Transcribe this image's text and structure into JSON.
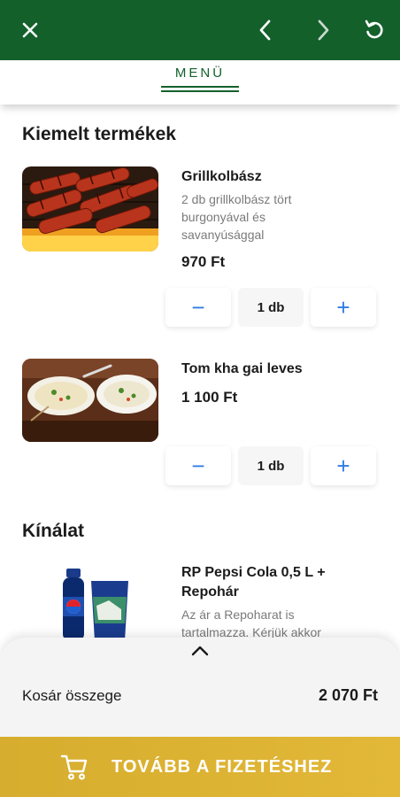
{
  "header": {
    "close_icon": "close-icon",
    "back_icon": "chevron-left-icon",
    "forward_icon": "chevron-right-icon",
    "refresh_icon": "refresh-icon",
    "bg_color": "#13602b"
  },
  "tabs": {
    "menu_label": "MENÜ"
  },
  "featured": {
    "title": "Kiemelt termékek",
    "items": [
      {
        "name": "Grillkolbász",
        "description": "2 db grillkolbász tört burgonyával és savanyúsággal",
        "price": "970 Ft",
        "quantity": "1 db",
        "minus": "−",
        "plus": "+"
      },
      {
        "name": "Tom kha gai leves",
        "price": "1 100 Ft",
        "quantity": "1 db",
        "minus": "−",
        "plus": "+"
      }
    ]
  },
  "offer": {
    "title": "Kínálat",
    "items": [
      {
        "name": "RP Pepsi Cola 0,5 L + Repohár",
        "description": "Az ár a Repoharat is tartalmazza. Kérjük akkor"
      }
    ]
  },
  "cart": {
    "label": "Kosár összege",
    "total": "2 070 Ft"
  },
  "checkout": {
    "label": "TOVÁBB A FIZETÉSHEZ",
    "icon": "cart-icon",
    "color": "#dcb233"
  }
}
